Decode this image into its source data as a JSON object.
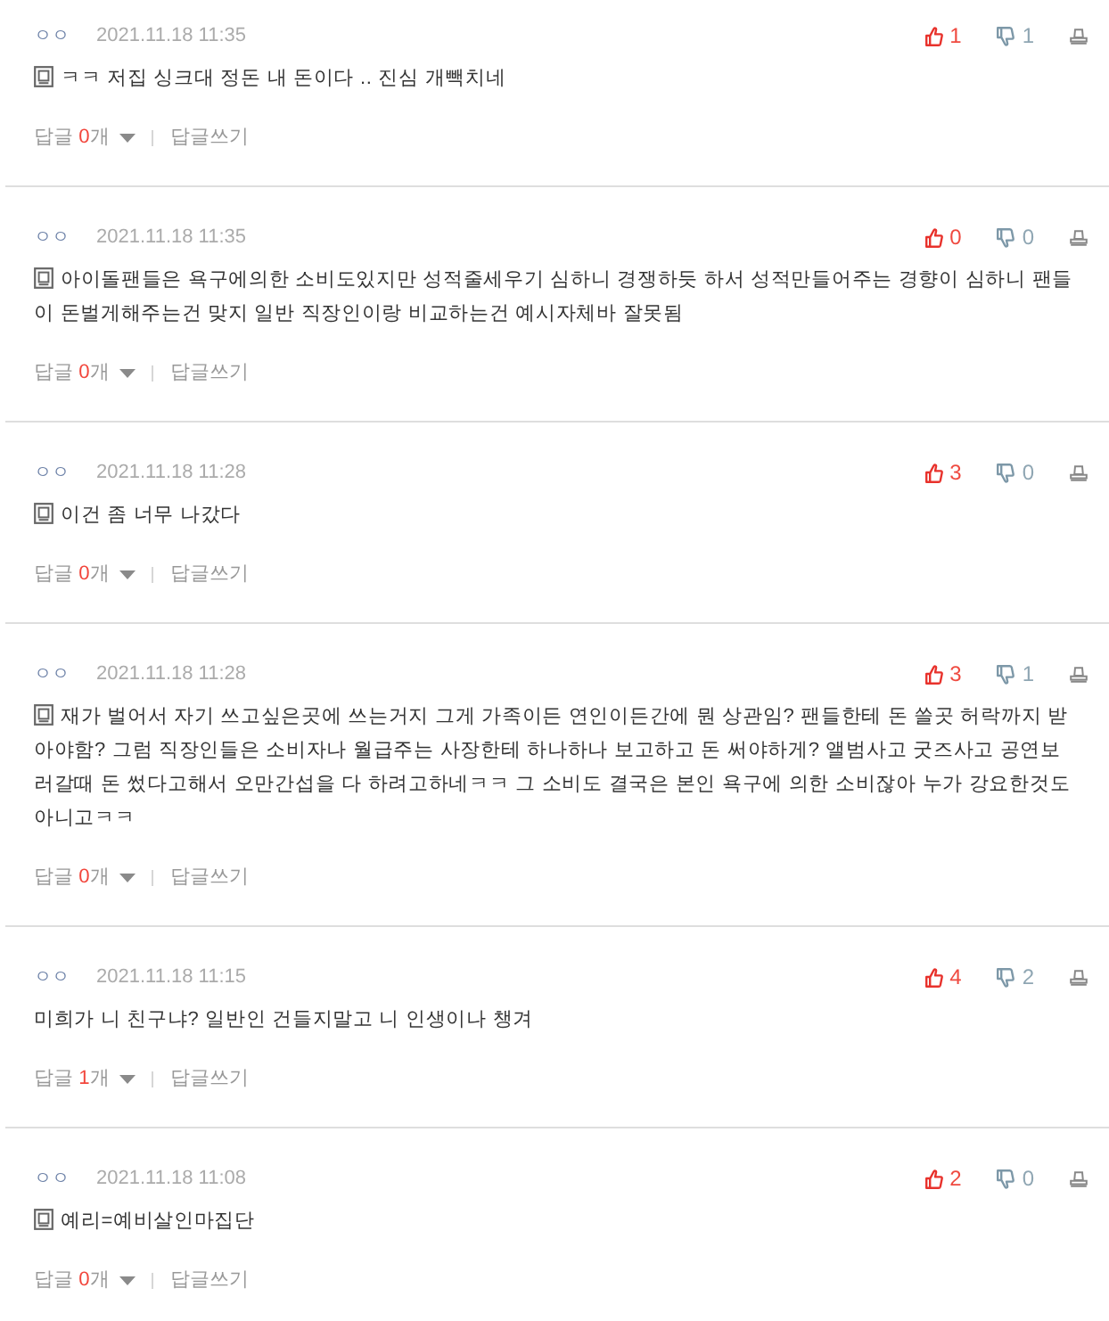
{
  "comments": [
    {
      "author": "ㅇㅇ",
      "date": "2021.11.18 11:35",
      "likes": "1",
      "dislikes": "1",
      "note_icon": true,
      "text": "ㅋㅋ 저집 싱크대 정돈 내 돈이다 .. 진심 개빽치네",
      "reply_label": "답글",
      "reply_count": "0",
      "reply_unit": "개",
      "write_reply": "답글쓰기"
    },
    {
      "author": "ㅇㅇ",
      "date": "2021.11.18 11:35",
      "likes": "0",
      "dislikes": "0",
      "note_icon": true,
      "text": "아이돌팬들은 욕구에의한 소비도있지만 성적줄세우기 심하니 경쟁하듯 하서 성적만들어주는 경향이 심하니 팬들이 돈벌게해주는건 맞지 일반 직장인이랑 비교하는건 예시자체바 잘못됨",
      "reply_label": "답글",
      "reply_count": "0",
      "reply_unit": "개",
      "write_reply": "답글쓰기"
    },
    {
      "author": "ㅇㅇ",
      "date": "2021.11.18 11:28",
      "likes": "3",
      "dislikes": "0",
      "note_icon": true,
      "text": "이건 좀 너무 나갔다",
      "reply_label": "답글",
      "reply_count": "0",
      "reply_unit": "개",
      "write_reply": "답글쓰기"
    },
    {
      "author": "ㅇㅇ",
      "date": "2021.11.18 11:28",
      "likes": "3",
      "dislikes": "1",
      "note_icon": true,
      "text": "재가 벌어서 자기 쓰고싶은곳에 쓰는거지 그게 가족이든 연인이든간에 뭔 상관임? 팬들한테 돈 쓸곳 허락까지 받아야함? 그럼 직장인들은 소비자나 월급주는 사장한테 하나하나 보고하고 돈 써야하게? 앨범사고 굿즈사고 공연보러갈때 돈 썼다고해서 오만간섭을 다 하려고하네ㅋㅋ 그 소비도 결국은 본인 욕구에 의한 소비잖아 누가 강요한것도 아니고ㅋㅋ",
      "reply_label": "답글",
      "reply_count": "0",
      "reply_unit": "개",
      "write_reply": "답글쓰기"
    },
    {
      "author": "ㅇㅇ",
      "date": "2021.11.18 11:15",
      "likes": "4",
      "dislikes": "2",
      "note_icon": false,
      "text": "미희가 니 친구냐? 일반인 건들지말고 니 인생이나 챙겨",
      "reply_label": "답글",
      "reply_count": "1",
      "reply_unit": "개",
      "write_reply": "답글쓰기"
    },
    {
      "author": "ㅇㅇ",
      "date": "2021.11.18 11:08",
      "likes": "2",
      "dislikes": "0",
      "note_icon": true,
      "text": "예리=예비살인마집단",
      "reply_label": "답글",
      "reply_count": "0",
      "reply_unit": "개",
      "write_reply": "답글쓰기"
    }
  ]
}
